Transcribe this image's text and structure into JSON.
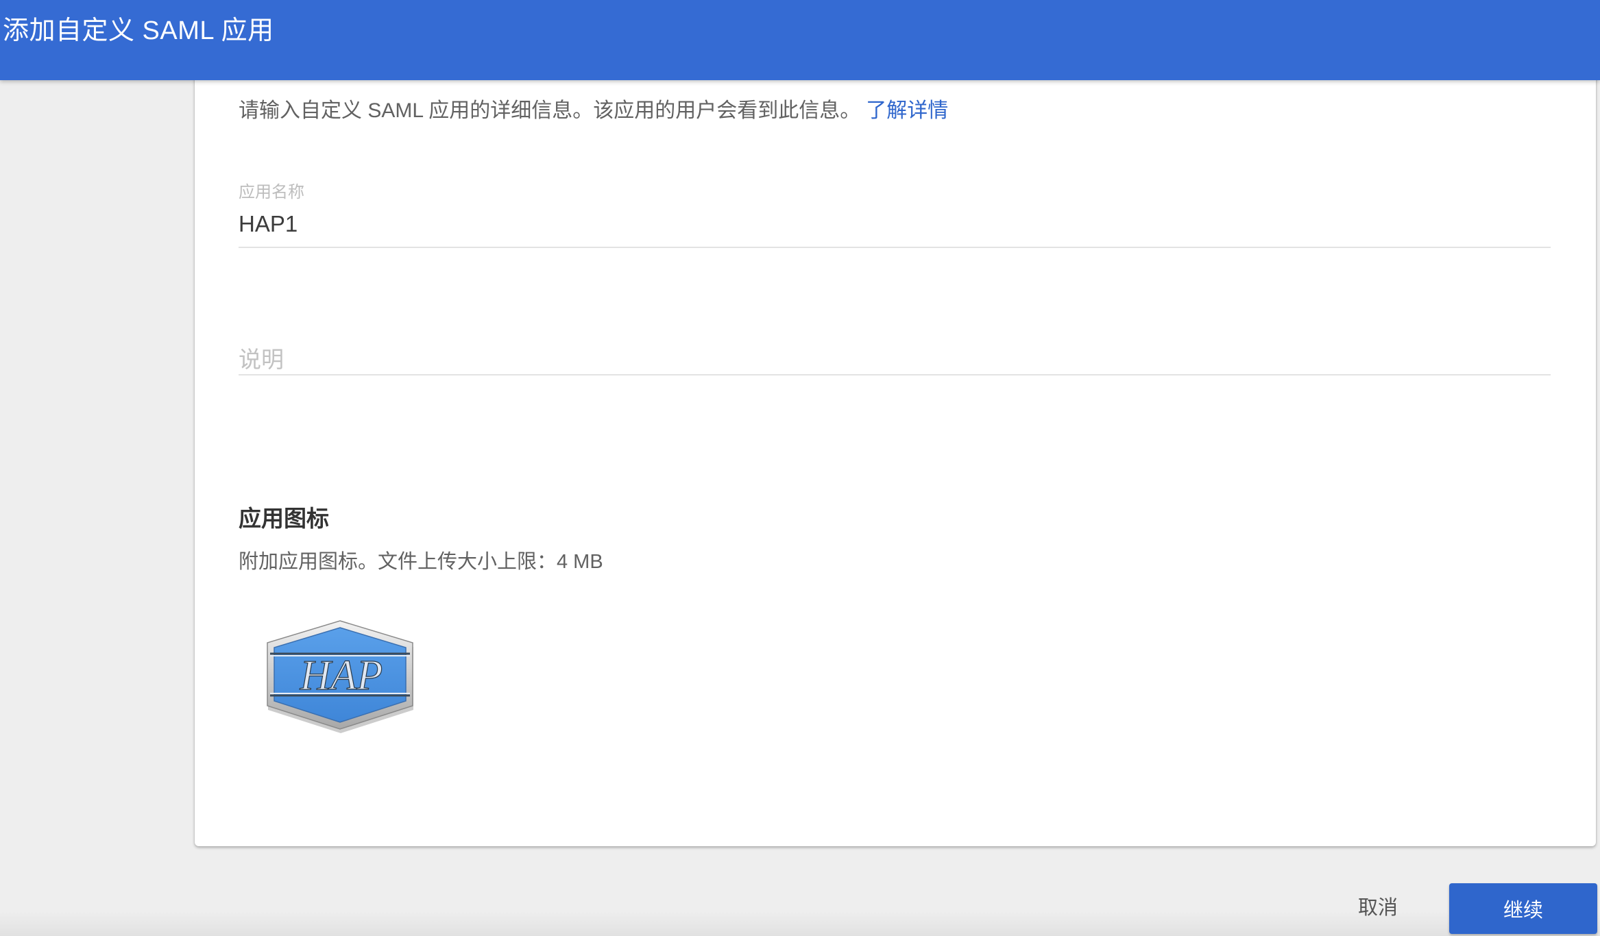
{
  "header": {
    "title": "添加自定义 SAML 应用"
  },
  "intro": {
    "text": "请输入自定义 SAML 应用的详细信息。该应用的用户会看到此信息。",
    "link": "了解详情"
  },
  "form": {
    "app_name": {
      "label": "应用名称",
      "value": "HAP1"
    },
    "description": {
      "placeholder": "说明",
      "value": ""
    }
  },
  "icon_section": {
    "title": "应用图标",
    "description": "附加应用图标。文件上传大小上限：4 MB",
    "logo_text": "HAP"
  },
  "actions": {
    "cancel_label": "取消",
    "continue_label": "继续"
  },
  "colors": {
    "header_bg": "#356bd3",
    "primary": "#2f66cc",
    "logo_fill": "#4a8fe0"
  }
}
